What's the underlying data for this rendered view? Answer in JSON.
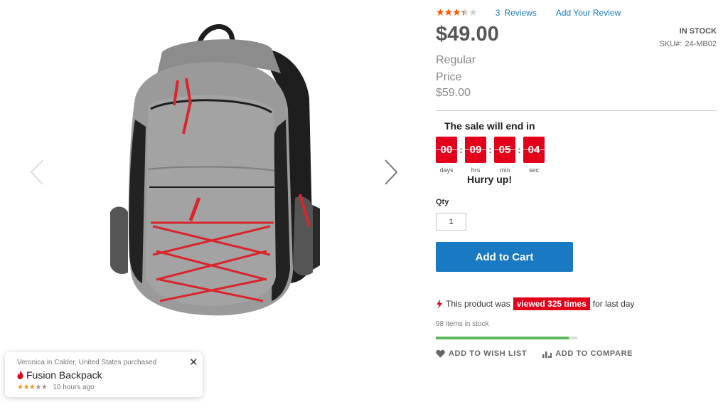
{
  "product": {
    "name": "Fusion Backpack",
    "rating_stars": 3.5,
    "reviews_count": "3",
    "reviews_label": "Reviews",
    "add_review_label": "Add Your Review",
    "price": "$49.00",
    "stock_status": "IN STOCK",
    "sku_label": "SKU#:",
    "sku_value": "24-MB02",
    "regular_label": "Regular Price",
    "regular_price": "$59.00"
  },
  "countdown": {
    "title": "The sale will end in",
    "days": "00",
    "hrs": "09",
    "min": "05",
    "sec": "04",
    "days_label": "days",
    "hrs_label": "hrs",
    "min_label": "min",
    "sec_label": "sec",
    "hurry": "Hurry up!"
  },
  "cart": {
    "qty_label": "Qty",
    "qty_value": "1",
    "add_to_cart": "Add to Cart"
  },
  "social_proof": {
    "viewed_prefix": "This product was",
    "viewed_badge": "viewed 325 times",
    "viewed_suffix": "for last day",
    "stock_count": "98 items in stock",
    "stock_progress_fraction": 0.94
  },
  "actions": {
    "wishlist": "ADD TO WISH LIST",
    "compare": "ADD TO COMPARE"
  },
  "notification": {
    "buyer": "Veronica in Calder, United States purchased",
    "product": "Fusion Backpack",
    "rating_stars": 3,
    "time_ago": "10 hours ago"
  },
  "colors": {
    "accent_blue": "#1979c3",
    "sale_red": "#e3001b",
    "star_orange": "#ff5501",
    "progress_green": "#5cb85c"
  },
  "icons": {
    "prev": "chevron-left-icon",
    "next": "chevron-right-icon",
    "flame": "flame-icon",
    "bolt": "bolt-icon",
    "heart": "heart-icon",
    "compare": "bar-chart-icon",
    "close": "close-icon"
  }
}
